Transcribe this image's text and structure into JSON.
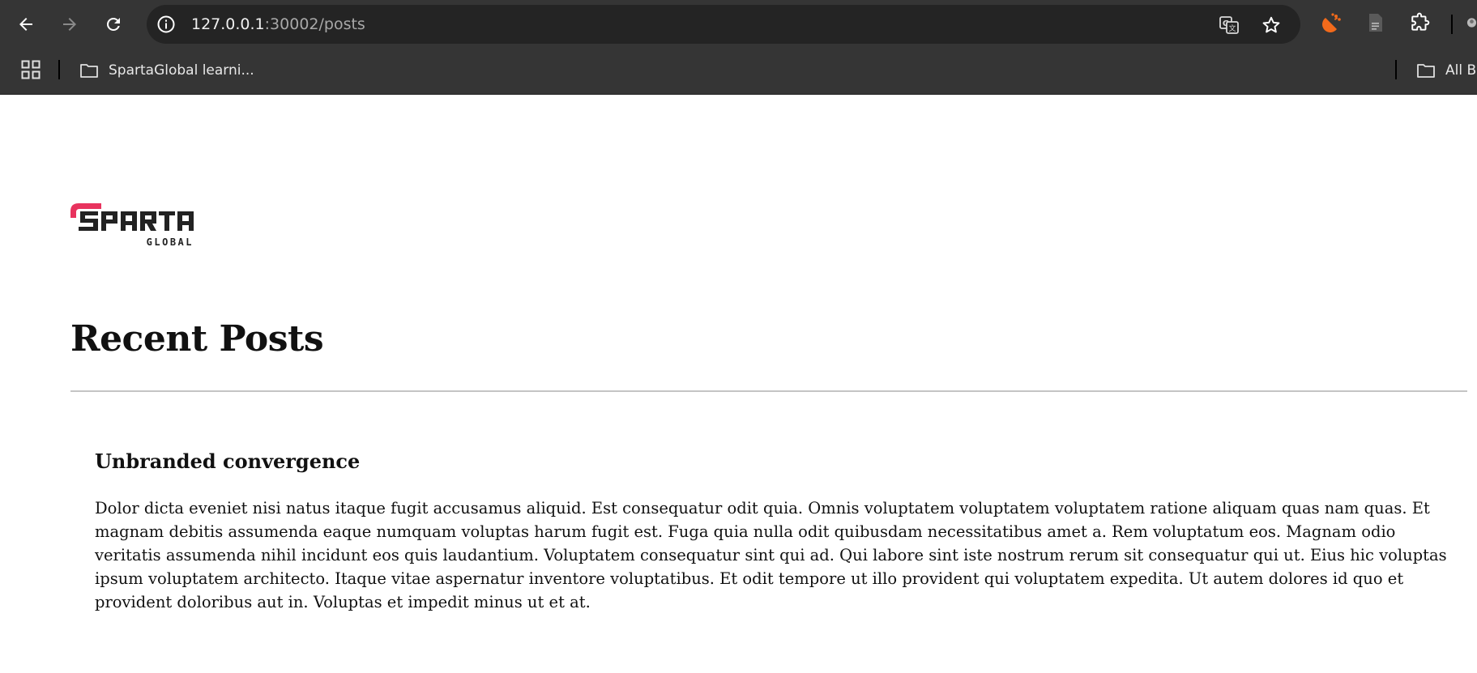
{
  "browser": {
    "url_host": "127.0.0.1",
    "url_path": ":30002/posts",
    "icons": {
      "back": "arrow-left-icon",
      "forward": "arrow-right-icon",
      "reload": "reload-icon",
      "site_info": "info-icon",
      "translate": "translate-icon",
      "bookmark": "star-icon",
      "extension_1": "orange-extension-icon",
      "extension_2": "document-icon",
      "extensions": "puzzle-icon"
    }
  },
  "bookmarks_bar": {
    "items": [
      {
        "label": "SpartaGlobal learni...",
        "icon": "folder-icon"
      }
    ],
    "all_bookmarks_label": "All Bo"
  },
  "page": {
    "logo": {
      "wordmark": "SPARTA",
      "subtitle": "GLOBAL",
      "accent_color": "#e8335e",
      "text_color": "#222222"
    },
    "heading": "Recent Posts",
    "posts": [
      {
        "title": "Unbranded convergence",
        "body": "Dolor dicta eveniet nisi natus itaque fugit accusamus aliquid. Est consequatur odit quia. Omnis voluptatem voluptatem voluptatem ratione aliquam quas nam quas. Et magnam debitis assumenda eaque numquam voluptas harum fugit est. Fuga quia nulla odit quibusdam necessitatibus amet a. Rem voluptatum eos. Magnam odio veritatis assumenda nihil incidunt eos quis laudantium. Voluptatem consequatur sint qui ad. Qui labore sint iste nostrum rerum sit consequatur qui ut. Eius hic voluptas ipsum voluptatem architecto. Itaque vitae aspernatur inventore voluptatibus. Et odit tempore ut illo provident qui voluptatem expedita. Ut autem dolores id quo et provident doloribus aut in. Voluptas et impedit minus ut et at."
      }
    ]
  }
}
